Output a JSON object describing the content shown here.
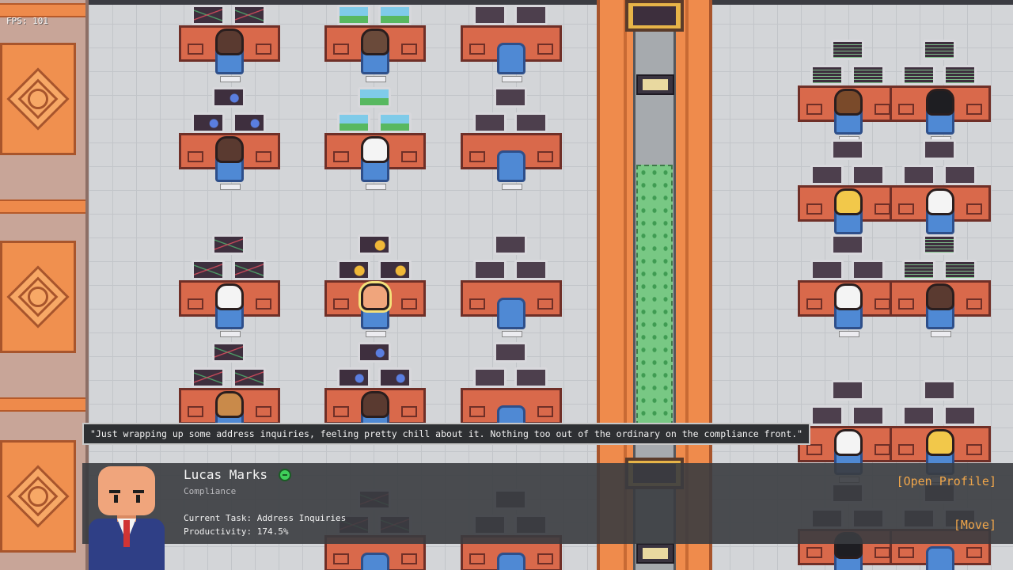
{
  "hud": {
    "fps_label": "FPS: 101"
  },
  "speech_bubble": {
    "text": "\"Just wrapping up some address inquiries, feeling pretty chill about it. Nothing too out of the ordinary on the compliance front.\""
  },
  "selected_employee": {
    "name": "Lucas Marks",
    "department": "Compliance",
    "current_task": "Current Task: Address Inquiries",
    "productivity": "Productivity: 174.5%",
    "status": "happy-face-icon",
    "status_color": "#3fcf5a"
  },
  "actions": {
    "open_profile": "[Open Profile]",
    "move": "[Move]"
  },
  "colors": {
    "accent": "#f0a64a",
    "desk": "#d9694b",
    "chair": "#4f89d4",
    "corridor": "#ef8b4c"
  }
}
